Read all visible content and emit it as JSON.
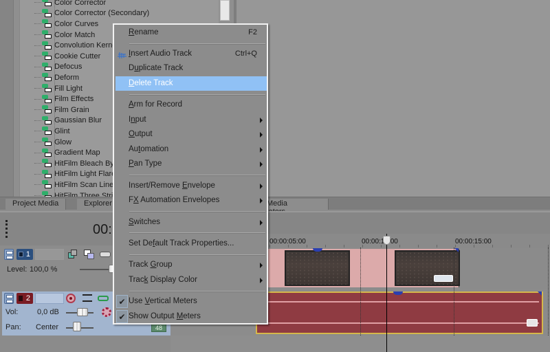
{
  "fx_tree": {
    "items": [
      "Color Corrector",
      "Color Corrector (Secondary)",
      "Color Curves",
      "Color Match",
      "Convolution Kernel",
      "Cookie Cutter",
      "Defocus",
      "Deform",
      "Fill Light",
      "Film Effects",
      "Film Grain",
      "Gaussian Blur",
      "Glint",
      "Glow",
      "Gradient Map",
      "HitFilm Bleach Bypass",
      "HitFilm Light Flares",
      "HitFilm Scan Lines",
      "HitFilm Three Strip"
    ],
    "icon": "plugin-fx-icon"
  },
  "tabs": [
    {
      "label": "Project Media"
    },
    {
      "label": "Explorer"
    },
    {
      "label": "Media Generators"
    }
  ],
  "timeline": {
    "time_display": "00:",
    "ruler_labels": [
      "00:00:05:00",
      "00:00:10:00",
      "00:00:15:00"
    ]
  },
  "tracks": [
    {
      "type": "video",
      "number": "1",
      "level_label": "Level:",
      "level_value": "100,0 %",
      "level_fraction": 1.0,
      "color": "#2b4f7e"
    },
    {
      "type": "audio",
      "number": "2",
      "vol_label": "Vol:",
      "vol_value": "0,0 dB",
      "pan_label": "Pan:",
      "pan_value": "Center",
      "meter_label": "48",
      "color": "#7a1c24"
    }
  ],
  "context_menu": {
    "items": [
      {
        "label": "Rename",
        "mnemonic": "R",
        "shortcut": "F2"
      },
      {
        "label": "Insert Audio Track",
        "mnemonic": "I",
        "shortcut": "Ctrl+Q",
        "icon": "audio-track-icon"
      },
      {
        "label": "Duplicate Track",
        "mnemonic": "u"
      },
      {
        "label": "Delete Track",
        "mnemonic": "D",
        "highlighted": true
      },
      {
        "label": "Arm for Record",
        "mnemonic": "A"
      },
      {
        "label": "Input",
        "mnemonic": "n",
        "submenu": true
      },
      {
        "label": "Output",
        "mnemonic": "O",
        "submenu": true
      },
      {
        "label": "Automation",
        "mnemonic": "t",
        "submenu": true
      },
      {
        "label": "Pan Type",
        "mnemonic": "P",
        "submenu": true
      },
      {
        "label": "Insert/Remove Envelope",
        "mnemonic": "E",
        "submenu": true
      },
      {
        "label": "FX Automation Envelopes",
        "mnemonic": "X",
        "submenu": true
      },
      {
        "label": "Switches",
        "mnemonic": "S",
        "submenu": true
      },
      {
        "label": "Set Default Track Properties...",
        "mnemonic": "f"
      },
      {
        "label": "Track Group",
        "mnemonic": "G",
        "submenu": true
      },
      {
        "label": "Track Display Color",
        "mnemonic": "k",
        "submenu": true
      },
      {
        "label": "Use Vertical Meters",
        "mnemonic": "V",
        "checked": true
      },
      {
        "label": "Show Output Meters",
        "mnemonic": "M",
        "checked": true
      }
    ],
    "highlight_color": "#90c1f5"
  },
  "colors": {
    "video_event": "#dcaaaa",
    "audio_event": "#8f3b42",
    "audio_event_border": "#d6b74a",
    "audio_track_header": "#a2b5cf"
  }
}
